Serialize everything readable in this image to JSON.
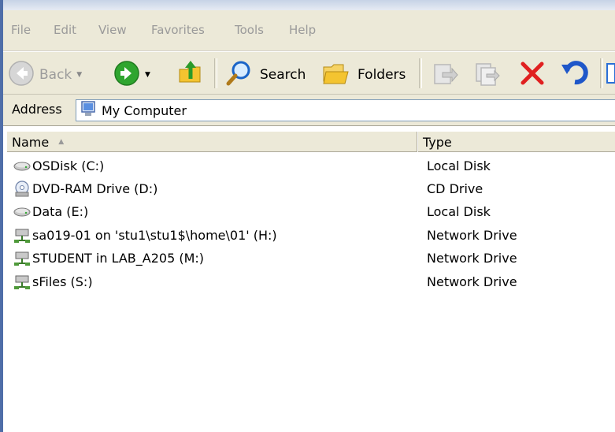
{
  "menu": [
    "File",
    "Edit",
    "View",
    "Favorites",
    "Tools",
    "Help"
  ],
  "toolbar": {
    "back_label": "Back",
    "search_label": "Search",
    "folders_label": "Folders"
  },
  "address": {
    "label": "Address",
    "value": "My Computer"
  },
  "columns": {
    "name": "Name",
    "type": "Type"
  },
  "items": [
    {
      "name": "OSDisk (C:)",
      "type": "Local Disk",
      "icon": "hard-disk-icon"
    },
    {
      "name": "DVD-RAM Drive (D:)",
      "type": "CD Drive",
      "icon": "cd-drive-icon"
    },
    {
      "name": "Data (E:)",
      "type": "Local Disk",
      "icon": "hard-disk-icon"
    },
    {
      "name": "sa019-01 on 'stu1\\stu1$\\home\\01' (H:)",
      "type": "Network Drive",
      "icon": "network-drive-icon"
    },
    {
      "name": "STUDENT in LAB_A205 (M:)",
      "type": "Network Drive",
      "icon": "network-drive-icon"
    },
    {
      "name": "sFiles (S:)",
      "type": "Network Drive",
      "icon": "network-drive-icon"
    }
  ],
  "colors": {
    "toolbar_bg": "#ece9d8",
    "forward_green": "#2fa52f",
    "delete_red": "#e02020",
    "undo_blue": "#1f57c9"
  }
}
